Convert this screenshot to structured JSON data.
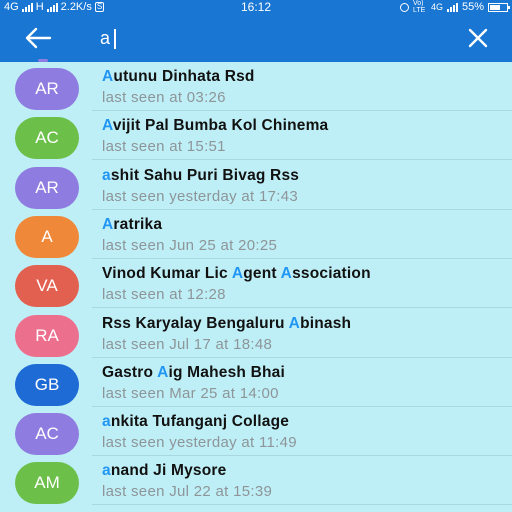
{
  "status_bar": {
    "left_text": "4G",
    "network_label": "H",
    "data_speed": "2.2K/s",
    "s_badge": "S",
    "time": "16:12",
    "network_small": "Vo) LTE",
    "net4g": "4G",
    "battery": "55%"
  },
  "toolbar": {
    "search_value": "a",
    "back_icon": "arrow-left-icon",
    "close_icon": "close-icon"
  },
  "colors": {
    "toolbar": "#1976d2",
    "background": "#bfeff6",
    "highlight": "#2196f3"
  },
  "contacts": [
    {
      "initials": "AR",
      "color": "#8e7ce0",
      "name_parts": [
        {
          "t": "A",
          "h": true
        },
        {
          "t": "utunu Dinhata Rsd",
          "h": false
        }
      ],
      "last_seen": "last seen at 03:26"
    },
    {
      "initials": "AC",
      "color": "#6cc04a",
      "name_parts": [
        {
          "t": "A",
          "h": true
        },
        {
          "t": "vijit Pal Bumba Kol Chinema",
          "h": false
        }
      ],
      "last_seen": "last seen at 15:51"
    },
    {
      "initials": "AR",
      "color": "#8e7ce0",
      "name_parts": [
        {
          "t": "a",
          "h": true
        },
        {
          "t": "shit Sahu Puri Bivag Rss",
          "h": false
        }
      ],
      "last_seen": "last seen yesterday at 17:43"
    },
    {
      "initials": "A",
      "color": "#f0883a",
      "name_parts": [
        {
          "t": "A",
          "h": true
        },
        {
          "t": "ratrika",
          "h": false
        }
      ],
      "last_seen": "last seen Jun 25 at 20:25"
    },
    {
      "initials": "VA",
      "color": "#e2604f",
      "name_parts": [
        {
          "t": "Vinod Kumar Lic ",
          "h": false
        },
        {
          "t": "A",
          "h": true
        },
        {
          "t": "gent ",
          "h": false
        },
        {
          "t": "A",
          "h": true
        },
        {
          "t": "ssociation",
          "h": false
        }
      ],
      "last_seen": "last seen at 12:28"
    },
    {
      "initials": "RA",
      "color": "#ec6f8e",
      "name_parts": [
        {
          "t": "Rss Karyalay Bengaluru ",
          "h": false
        },
        {
          "t": "A",
          "h": true
        },
        {
          "t": "binash",
          "h": false
        }
      ],
      "last_seen": "last seen Jul 17 at 18:48"
    },
    {
      "initials": "GB",
      "color": "#1e6bd6",
      "name_parts": [
        {
          "t": "Gastro ",
          "h": false
        },
        {
          "t": "A",
          "h": true
        },
        {
          "t": "ig Mahesh Bhai",
          "h": false
        }
      ],
      "last_seen": "last seen Mar 25 at 14:00"
    },
    {
      "initials": "AC",
      "color": "#8e7ce0",
      "name_parts": [
        {
          "t": "a",
          "h": true
        },
        {
          "t": "nkita Tufanganj Collage",
          "h": false
        }
      ],
      "last_seen": "last seen yesterday at 11:49"
    },
    {
      "initials": "AM",
      "color": "#6cc04a",
      "name_parts": [
        {
          "t": "a",
          "h": true
        },
        {
          "t": "nand Ji Mysore",
          "h": false
        }
      ],
      "last_seen": "last seen Jul 22 at 15:39"
    }
  ]
}
